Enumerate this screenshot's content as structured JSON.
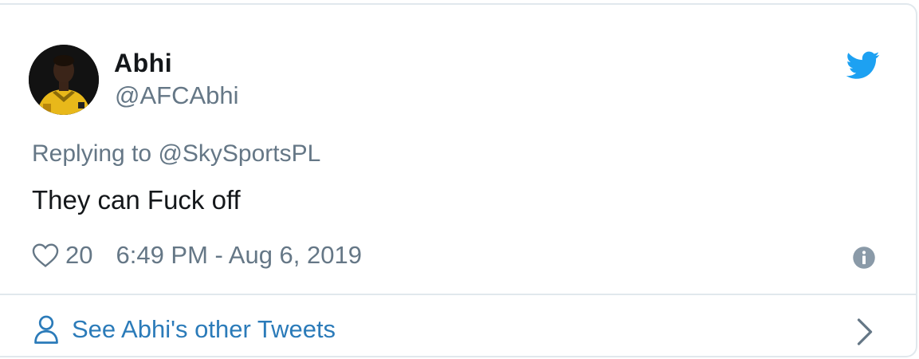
{
  "author": {
    "display_name": "Abhi",
    "handle": "@AFCAbhi",
    "avatar_icon": "profile-photo"
  },
  "tweet": {
    "reply_prefix": "Replying to",
    "reply_to": "@SkySportsPL",
    "text": "They can Fuck off",
    "like_count": "20",
    "timestamp": "6:49 PM - Aug 6, 2019"
  },
  "footer": {
    "see_other_label": "See Abhi's other Tweets"
  },
  "icons": {
    "brand": "twitter-bird-icon",
    "like": "heart-icon",
    "info": "info-icon",
    "profile": "person-icon",
    "navigate": "chevron-right-icon"
  },
  "colors": {
    "twitter_blue": "#1da1f2",
    "link_blue": "#2b7bb9",
    "secondary_text": "#657786",
    "primary_text": "#14171a",
    "border": "#e1e8ed"
  }
}
